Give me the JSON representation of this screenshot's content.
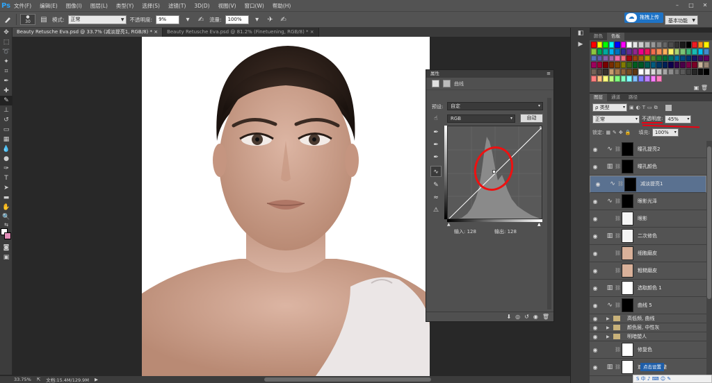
{
  "app": {
    "logo": "Ps"
  },
  "menu": [
    "文件(F)",
    "编辑(E)",
    "图像(I)",
    "图层(L)",
    "类型(Y)",
    "选择(S)",
    "滤镜(T)",
    "3D(D)",
    "视图(V)",
    "窗口(W)",
    "帮助(H)"
  ],
  "window_buttons": {
    "minimize": "–",
    "maximize": "□",
    "close": "✕"
  },
  "options": {
    "brush_size": "30",
    "mode_label": "模式:",
    "mode_value": "正常",
    "opacity_label": "不透明度:",
    "opacity_value": "9%",
    "flow_label": "流量:",
    "flow_value": "100%"
  },
  "upload_button": {
    "label": "拖拽上传"
  },
  "workspace": {
    "label": "基本功能"
  },
  "tabs": [
    {
      "label": "Beauty Retusche Eva.psd @ 33.7% (减淡提亮1, RGB/8) *  ×",
      "active": true
    },
    {
      "label": "Beauty Retusche Eva.psd @ 81.2% (Finetuening, RGB/8) *  ×",
      "active": false
    }
  ],
  "statusbar": {
    "zoom": "33.75%",
    "doc": "文档:15.4M/129.9M",
    "arrow": "▶"
  },
  "properties": {
    "title": "属性",
    "header": "曲线",
    "preset_label": "预设:",
    "preset_value": "自定",
    "channel_value": "RGB",
    "auto_label": "自动",
    "input_label": "输入: 128",
    "output_label": "输出: 128"
  },
  "swatch_panel": {
    "tabs": [
      "颜色",
      "色板"
    ]
  },
  "swatch_colors": [
    "#ff0000",
    "#ffff00",
    "#00ff00",
    "#00ffff",
    "#0000ff",
    "#ff00ff",
    "#ffffff",
    "#e6e6e6",
    "#cccccc",
    "#b3b3b3",
    "#999999",
    "#808080",
    "#666666",
    "#4d4d4d",
    "#333333",
    "#1a1a1a",
    "#000000",
    "#ed1c24",
    "#f7941d",
    "#fff200",
    "#8dc63f",
    "#00a651",
    "#00a99d",
    "#00aeef",
    "#0072bc",
    "#2e3192",
    "#662d91",
    "#92278f",
    "#ec008c",
    "#ed145b",
    "#f26c4f",
    "#f68e55",
    "#fbaf5c",
    "#fff467",
    "#acd373",
    "#7cc576",
    "#3bb878",
    "#1abbb4",
    "#00bff3",
    "#438ccb",
    "#5574b9",
    "#605ca8",
    "#8560a8",
    "#a763a8",
    "#f06ea9",
    "#f26d7d",
    "#9e0b0f",
    "#a0410d",
    "#a36209",
    "#aba000",
    "#598527",
    "#1a7b30",
    "#007236",
    "#00746b",
    "#0076a3",
    "#004a80",
    "#003471",
    "#1b1464",
    "#440e62",
    "#630460",
    "#9e005d",
    "#9e0039",
    "#790000",
    "#7b2e00",
    "#7d4900",
    "#827b00",
    "#406618",
    "#005e20",
    "#005826",
    "#005952",
    "#005b7f",
    "#003663",
    "#002157",
    "#0d004c",
    "#32004b",
    "#4b0049",
    "#7b0046",
    "#7a0026",
    "#c7b299",
    "#998675",
    "#736357",
    "#534741",
    "#37302a",
    "#c69c6d",
    "#a67c52",
    "#8c6239",
    "#754c24",
    "#603913",
    "#ffffff",
    "#f2f2f2",
    "#d9d9d9",
    "#bfbfbf",
    "#a6a6a6",
    "#8c8c8c",
    "#737373",
    "#595959",
    "#404040",
    "#262626",
    "#0d0d0d",
    "#000000",
    "#ff8080",
    "#ffbf80",
    "#ffff80",
    "#bfff80",
    "#80ff80",
    "#80ffbf",
    "#80ffff",
    "#80bfff",
    "#8080ff",
    "#bf80ff",
    "#ff80ff",
    "#ff80bf"
  ],
  "layers_panel": {
    "tabs": [
      "图层",
      "通道",
      "路径"
    ],
    "filter_value": "类型",
    "blend_value": "正常",
    "opacity_label": "不透明度:",
    "opacity_value": "45%",
    "lock_label": "锁定:",
    "fill_label": "填充:",
    "fill_value": "100%"
  },
  "layers": [
    {
      "name": "瞳孔提亮2",
      "type": "curves",
      "thumb": "#000000",
      "selected": false
    },
    {
      "name": "瞳孔颜色",
      "type": "levels",
      "thumb": "#000000",
      "selected": false
    },
    {
      "name": "减淡提亮1",
      "type": "curves",
      "thumb": "#000000",
      "selected": true
    },
    {
      "name": "眼影光泽",
      "type": "curves",
      "thumb": "#000000",
      "selected": false
    },
    {
      "name": "眼影",
      "type": "pixel",
      "thumb": "#f5f5f5",
      "selected": false
    },
    {
      "name": "二次修色",
      "type": "levels",
      "thumb": "#f5f5f5",
      "selected": false
    },
    {
      "name": "细胞磨皮",
      "type": "photo",
      "thumb": "#d9b19a",
      "selected": false
    },
    {
      "name": "粗糙磨皮",
      "type": "photo2",
      "thumb": "#d9b19a",
      "selected": false
    },
    {
      "name": "选取颜色 1",
      "type": "levels",
      "thumb": "#ffffff",
      "selected": false
    },
    {
      "name": "曲线 5",
      "type": "curves",
      "thumb": "#000000",
      "selected": false
    },
    {
      "name": "高低频, 曲线",
      "type": "group",
      "selected": false
    },
    {
      "name": "颜色层, 中性灰",
      "type": "group",
      "selected": false
    },
    {
      "name": "明暗塑人",
      "type": "group",
      "selected": false
    },
    {
      "name": "修复色",
      "type": "pixel",
      "thumb": "#ffffff",
      "selected": false
    },
    {
      "name": "遮盖效果调整",
      "type": "levels",
      "thumb": "#ffffff",
      "selected": false
    }
  ],
  "layer_tip": "点击设置",
  "ime_bar": "S 中 ♪ ⌨ ☺ ✎",
  "icons": {
    "eye": "eye-icon",
    "chain": "link-icon",
    "folder": "folder-icon"
  }
}
